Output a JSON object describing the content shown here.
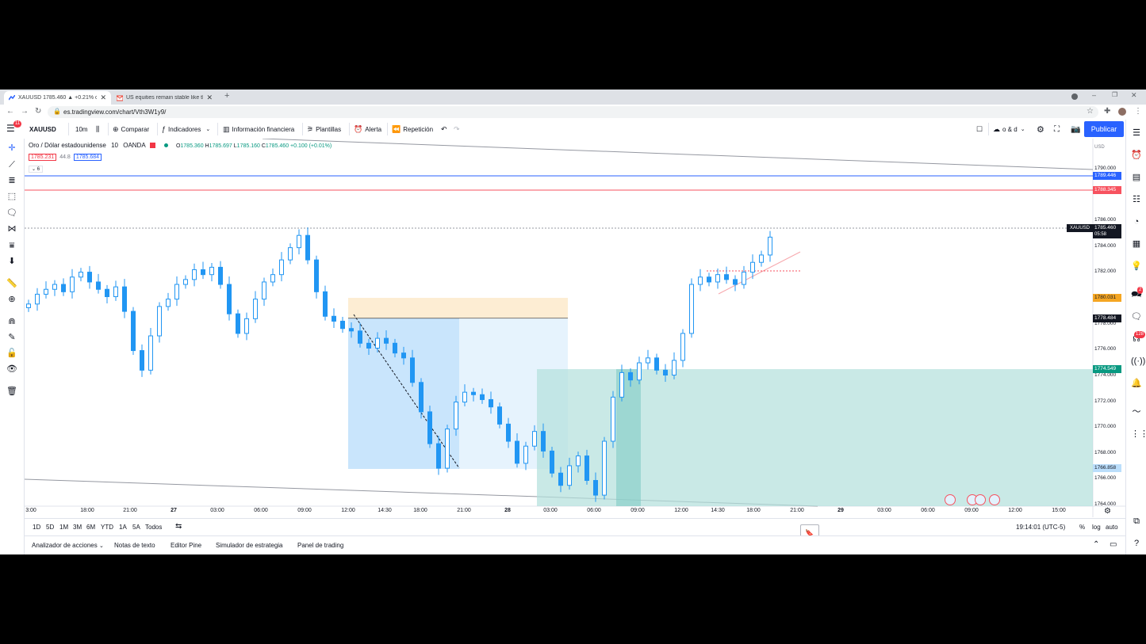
{
  "browser": {
    "tabs": [
      {
        "title": "XAUUSD 1785.460 ▲ +0.21% o...",
        "active": true
      },
      {
        "title": "US equities remain stable like th...",
        "active": false
      }
    ],
    "new_tab_label": "+",
    "url": "es.tradingview.com/chart/Vth3W1y9/"
  },
  "toolbar": {
    "symbol": "XAUUSD",
    "interval": "10m",
    "compare": "Comparar",
    "indicators": "Indicadores",
    "financials": "Información financiera",
    "templates": "Plantillas",
    "alert": "Alerta",
    "replay": "Repetición",
    "layout_name": "o & d",
    "publish": "Publicar"
  },
  "legend": {
    "name": "Oro / Dólar estadounidense",
    "interval": "10",
    "broker": "OANDA",
    "o_label": "O",
    "o": "1785.360",
    "h_label": "H",
    "h": "1785.697",
    "l_label": "L",
    "l": "1785.160",
    "c_label": "C",
    "c": "1785.460",
    "change": "+0.100 (+0.01%)",
    "bid": "1785.231",
    "spread": "44.8",
    "ask": "1785.684",
    "collapse": "6"
  },
  "price_axis": {
    "currency": "USD",
    "ticks": [
      "1792.000",
      "1790.000",
      "1788.000",
      "1786.000",
      "1784.000",
      "1782.000",
      "1780.000",
      "1778.000",
      "1776.000",
      "1774.000",
      "1772.000",
      "1770.000",
      "1768.000",
      "1766.000",
      "1764.000"
    ],
    "labels": [
      {
        "value": "1789.446",
        "color": "#2962ff"
      },
      {
        "value": "1788.345",
        "color": "#f7525f"
      },
      {
        "value": "1780.031",
        "color": "#f5a623"
      },
      {
        "value": "1778.484",
        "color": "#131722"
      },
      {
        "value": "1774.549",
        "color": "#089981"
      },
      {
        "value": "1766.858",
        "color": "#8fb8f0"
      }
    ],
    "last_symbol": "XAUUSD",
    "last_price": "1785.460",
    "countdown": "05:58"
  },
  "time_axis": {
    "ticks": [
      "3:00",
      "18:00",
      "21:00",
      "27",
      "03:00",
      "06:00",
      "09:00",
      "12:00",
      "14:30",
      "18:00",
      "21:00",
      "28",
      "03:00",
      "06:00",
      "09:00",
      "12:00",
      "14:30",
      "18:00",
      "21:00",
      "29",
      "03:00",
      "06:00",
      "09:00",
      "12:00",
      "15:00"
    ]
  },
  "range_bar": {
    "ranges": [
      "1D",
      "5D",
      "1M",
      "3M",
      "6M",
      "YTD",
      "1A",
      "5A",
      "Todos"
    ],
    "clock": "19:14:01 (UTC-5)",
    "percent": "%",
    "log": "log",
    "auto": "auto"
  },
  "panels": [
    "Analizador de acciones",
    "Notas de texto",
    "Editor Pine",
    "Simulador de estrategia",
    "Panel de trading"
  ],
  "right_badges": {
    "notifications": "2",
    "chat": "128"
  },
  "menu_badge": "11",
  "chart_data": {
    "type": "candlestick",
    "symbol": "XAUUSD",
    "interval": "10m",
    "ylim": [
      1763.5,
      1793.5
    ],
    "series": [
      {
        "name": "XAUUSD",
        "close": [
          1780.0,
          1780.8,
          1781.2,
          1781.6,
          1781.0,
          1782.2,
          1782.6,
          1781.8,
          1781.2,
          1780.6,
          1781.4,
          1779.4,
          1776.2,
          1774.6,
          1777.4,
          1779.8,
          1780.4,
          1781.6,
          1782.0,
          1782.8,
          1782.4,
          1783.0,
          1781.6,
          1779.2,
          1777.6,
          1778.8,
          1780.4,
          1781.8,
          1782.4,
          1783.6,
          1784.6,
          1785.6,
          1783.6,
          1781.0,
          1779.0,
          1778.6,
          1778.0,
          1777.8,
          1776.8,
          1776.4,
          1777.2,
          1776.8,
          1776.0,
          1775.6,
          1773.6,
          1771.2,
          1768.6,
          1766.6,
          1769.8,
          1772.0,
          1772.8,
          1772.6,
          1772.2,
          1771.6,
          1770.2,
          1768.8,
          1767.0,
          1768.4,
          1769.6,
          1768.0,
          1766.2,
          1765.2,
          1766.8,
          1767.6,
          1765.6,
          1764.4,
          1768.8,
          1772.4,
          1774.4,
          1773.8,
          1775.2,
          1775.6,
          1774.6,
          1774.2,
          1775.4,
          1777.6,
          1781.6,
          1782.2,
          1781.8,
          1782.4,
          1782.0,
          1781.6,
          1782.6,
          1783.4,
          1784.0,
          1785.46
        ]
      }
    ]
  }
}
